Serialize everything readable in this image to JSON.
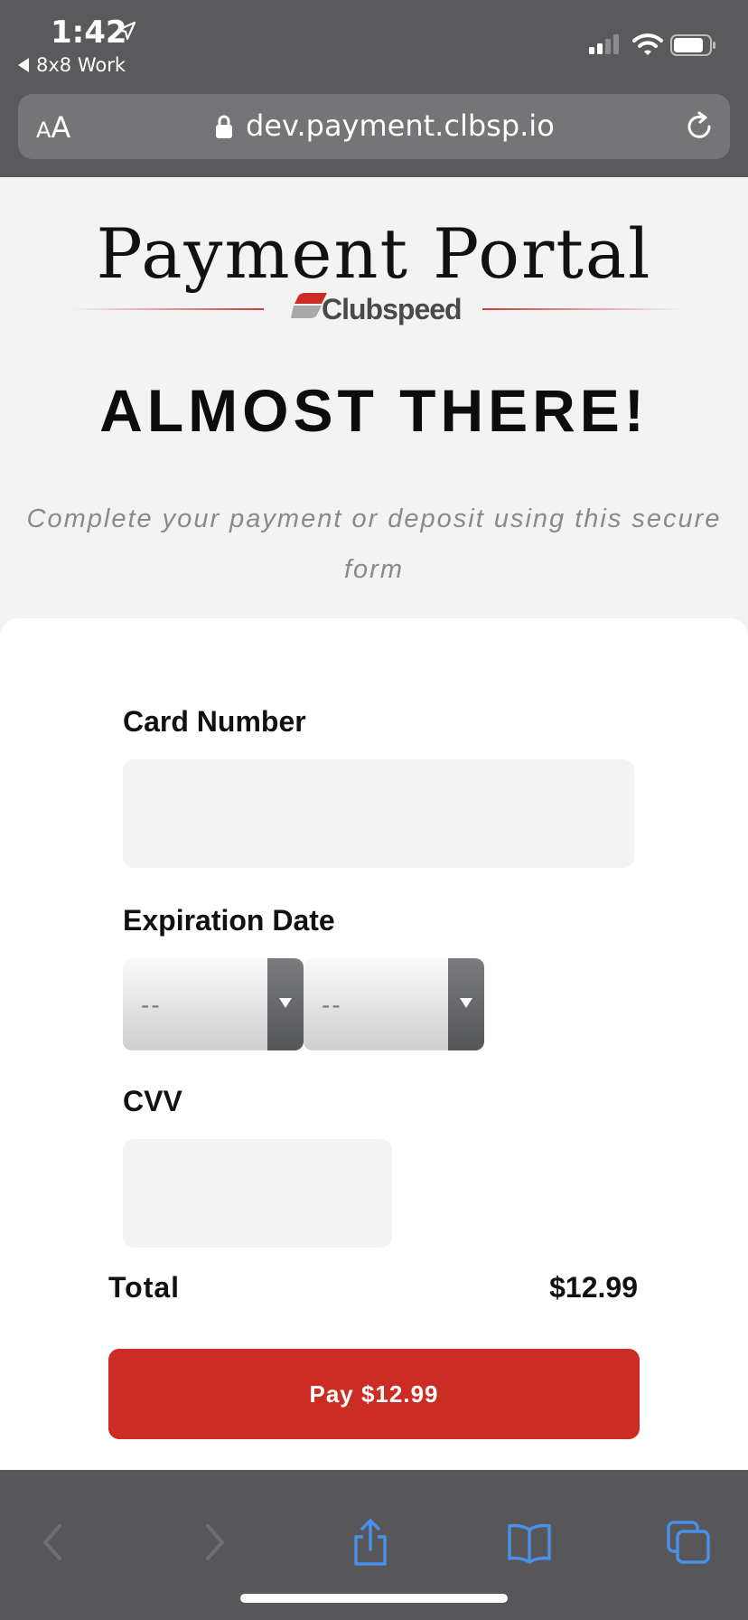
{
  "status_bar": {
    "time": "1:42",
    "back_app_label": "8x8 Work"
  },
  "address_bar": {
    "text_size_small": "A",
    "text_size_big": "A",
    "url": "dev.payment.clbsp.io"
  },
  "header": {
    "portal_title": "Payment Portal",
    "brand_name": "Clubspeed",
    "headline": "ALMOST THERE!",
    "subtitle": "Complete your payment or deposit using this secure form"
  },
  "form": {
    "card_number_label": "Card Number",
    "card_number_value": "",
    "expiration_label": "Expiration Date",
    "exp_month_value": "--",
    "exp_year_value": "--",
    "cvv_label": "CVV",
    "cvv_value": ""
  },
  "summary": {
    "total_label": "Total",
    "total_value": "$12.99",
    "pay_button_label": "Pay $12.99"
  },
  "colors": {
    "accent": "#cb2c23",
    "chrome": "#5a595b",
    "toolbar_icon_active": "#4a8fe8",
    "toolbar_icon_disabled": "#6f6f72"
  },
  "toolbar": {
    "icons": [
      "back-arrow-icon",
      "forward-arrow-icon",
      "share-icon",
      "bookmarks-icon",
      "tabs-icon"
    ]
  }
}
